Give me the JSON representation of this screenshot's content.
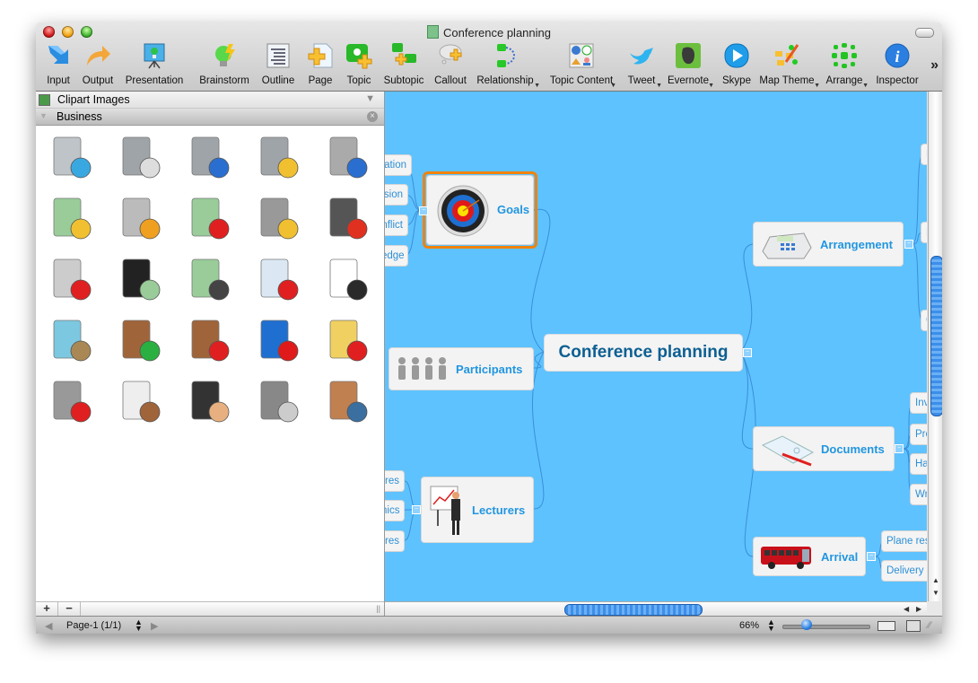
{
  "window": {
    "title": "Conference planning"
  },
  "toolbar": {
    "items": [
      {
        "label": "Input",
        "icon": "input-arrow-icon"
      },
      {
        "label": "Output",
        "icon": "output-arrow-icon"
      },
      {
        "label": "Presentation",
        "icon": "presentation-icon"
      },
      {
        "label": "Brainstorm",
        "icon": "brainstorm-bulb-icon"
      },
      {
        "label": "Outline",
        "icon": "outline-icon"
      },
      {
        "label": "Page",
        "icon": "page-add-icon"
      },
      {
        "label": "Topic",
        "icon": "topic-add-icon"
      },
      {
        "label": "Subtopic",
        "icon": "subtopic-add-icon"
      },
      {
        "label": "Callout",
        "icon": "callout-icon"
      },
      {
        "label": "Relationship",
        "icon": "relationship-icon",
        "dropdown": true
      },
      {
        "label": "Topic Content",
        "icon": "topic-content-icon",
        "dropdown": true
      },
      {
        "label": "Tweet",
        "icon": "twitter-bird-icon",
        "dropdown": true
      },
      {
        "label": "Evernote",
        "icon": "evernote-icon",
        "dropdown": true
      },
      {
        "label": "Skype",
        "icon": "skype-icon"
      },
      {
        "label": "Map Theme",
        "icon": "map-theme-icon",
        "dropdown": true
      },
      {
        "label": "Arrange",
        "icon": "arrange-icon",
        "dropdown": true
      },
      {
        "label": "Inspector",
        "icon": "inspector-info-icon"
      }
    ],
    "more": "»"
  },
  "panel": {
    "header": "Clipart Images",
    "category": "Business",
    "cliparts": [
      "atm-machine",
      "office-building",
      "office-buildings-blue",
      "building-with-money",
      "global-buildings",
      "time-percent-money",
      "calculator-dollar",
      "money-growth-arrow",
      "padlock-coins-key",
      "laptop-bar-chart",
      "cash-register",
      "briefcase-money",
      "scissors-cut-money",
      "document-signing-pen",
      "presenter-chart",
      "business-meeting",
      "export-box",
      "import-box",
      "target-bullseye",
      "dice",
      "shopping-basket",
      "delivery-truck",
      "handshake",
      "gears",
      "man-carrying-boxes"
    ],
    "footer": {
      "add": "+",
      "remove": "−"
    }
  },
  "mindmap": {
    "central": "Conference planning",
    "topics": [
      {
        "label": "Goals",
        "selected": true,
        "subtopics": [
          "ation",
          "ision",
          "nflict",
          "edge"
        ]
      },
      {
        "label": "Participants",
        "subtopics": []
      },
      {
        "label": "Lecturers",
        "subtopics": [
          "res",
          "nics",
          "res"
        ]
      },
      {
        "label": "Arrangement",
        "subtopics": [
          "R",
          "P",
          "C"
        ]
      },
      {
        "label": "Documents",
        "subtopics": [
          "Inv",
          "Pro",
          "Har",
          "Wri"
        ]
      },
      {
        "label": "Arrival",
        "subtopics": [
          "Plane res",
          "Delivery"
        ]
      }
    ]
  },
  "statusbar": {
    "page": "Page-1 (1/1)",
    "zoom": "66%",
    "zoom_slider_fraction": 0.3
  }
}
